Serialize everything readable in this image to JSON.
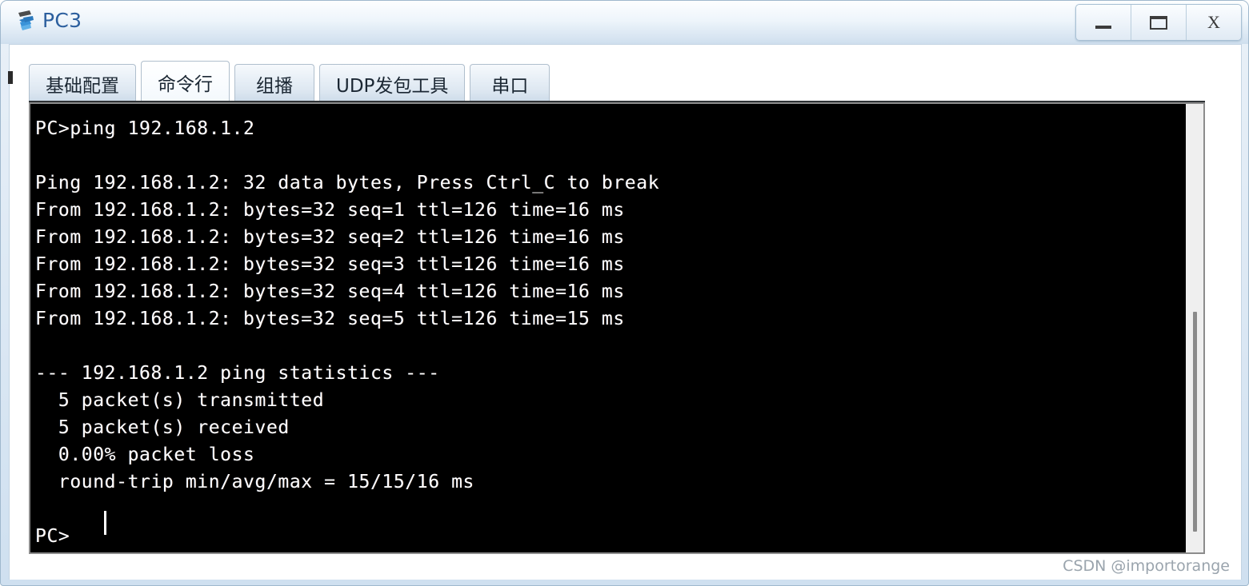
{
  "window": {
    "title": "PC3",
    "icon": "device-pc-icon",
    "controls": [
      {
        "name": "minimize-button",
        "glyph": "_",
        "label": "Minimize"
      },
      {
        "name": "maximize-button",
        "glyph": "▭",
        "label": "Maximize"
      },
      {
        "name": "close-button",
        "glyph": "X",
        "label": "Close"
      }
    ]
  },
  "tabs": [
    {
      "label": "基础配置",
      "name": "tab-basic-config",
      "active": false
    },
    {
      "label": "命令行",
      "name": "tab-command-line",
      "active": true
    },
    {
      "label": "组播",
      "name": "tab-multicast",
      "active": false
    },
    {
      "label": "UDP发包工具",
      "name": "tab-udp-packet-tool",
      "active": false
    },
    {
      "label": "串口",
      "name": "tab-serial-port",
      "active": false
    }
  ],
  "terminal": {
    "lines": [
      "PC>ping 192.168.1.2",
      "",
      "Ping 192.168.1.2: 32 data bytes, Press Ctrl_C to break",
      "From 192.168.1.2: bytes=32 seq=1 ttl=126 time=16 ms",
      "From 192.168.1.2: bytes=32 seq=2 ttl=126 time=16 ms",
      "From 192.168.1.2: bytes=32 seq=3 ttl=126 time=16 ms",
      "From 192.168.1.2: bytes=32 seq=4 ttl=126 time=16 ms",
      "From 192.168.1.2: bytes=32 seq=5 ttl=126 time=15 ms",
      "",
      "--- 192.168.1.2 ping statistics ---",
      "  5 packet(s) transmitted",
      "  5 packet(s) received",
      "  0.00% packet loss",
      "  round-trip min/avg/max = 15/15/16 ms",
      "",
      "PC>"
    ],
    "prompt": "PC>",
    "target_ip": "192.168.1.2",
    "data_bytes": "32",
    "packets_transmitted": "5",
    "packets_received": "5",
    "packet_loss": "0.00%",
    "round_trip": "15/15/16 ms",
    "background": "#000000",
    "foreground": "#ffffff"
  },
  "watermark": {
    "text": "CSDN @importorange"
  }
}
